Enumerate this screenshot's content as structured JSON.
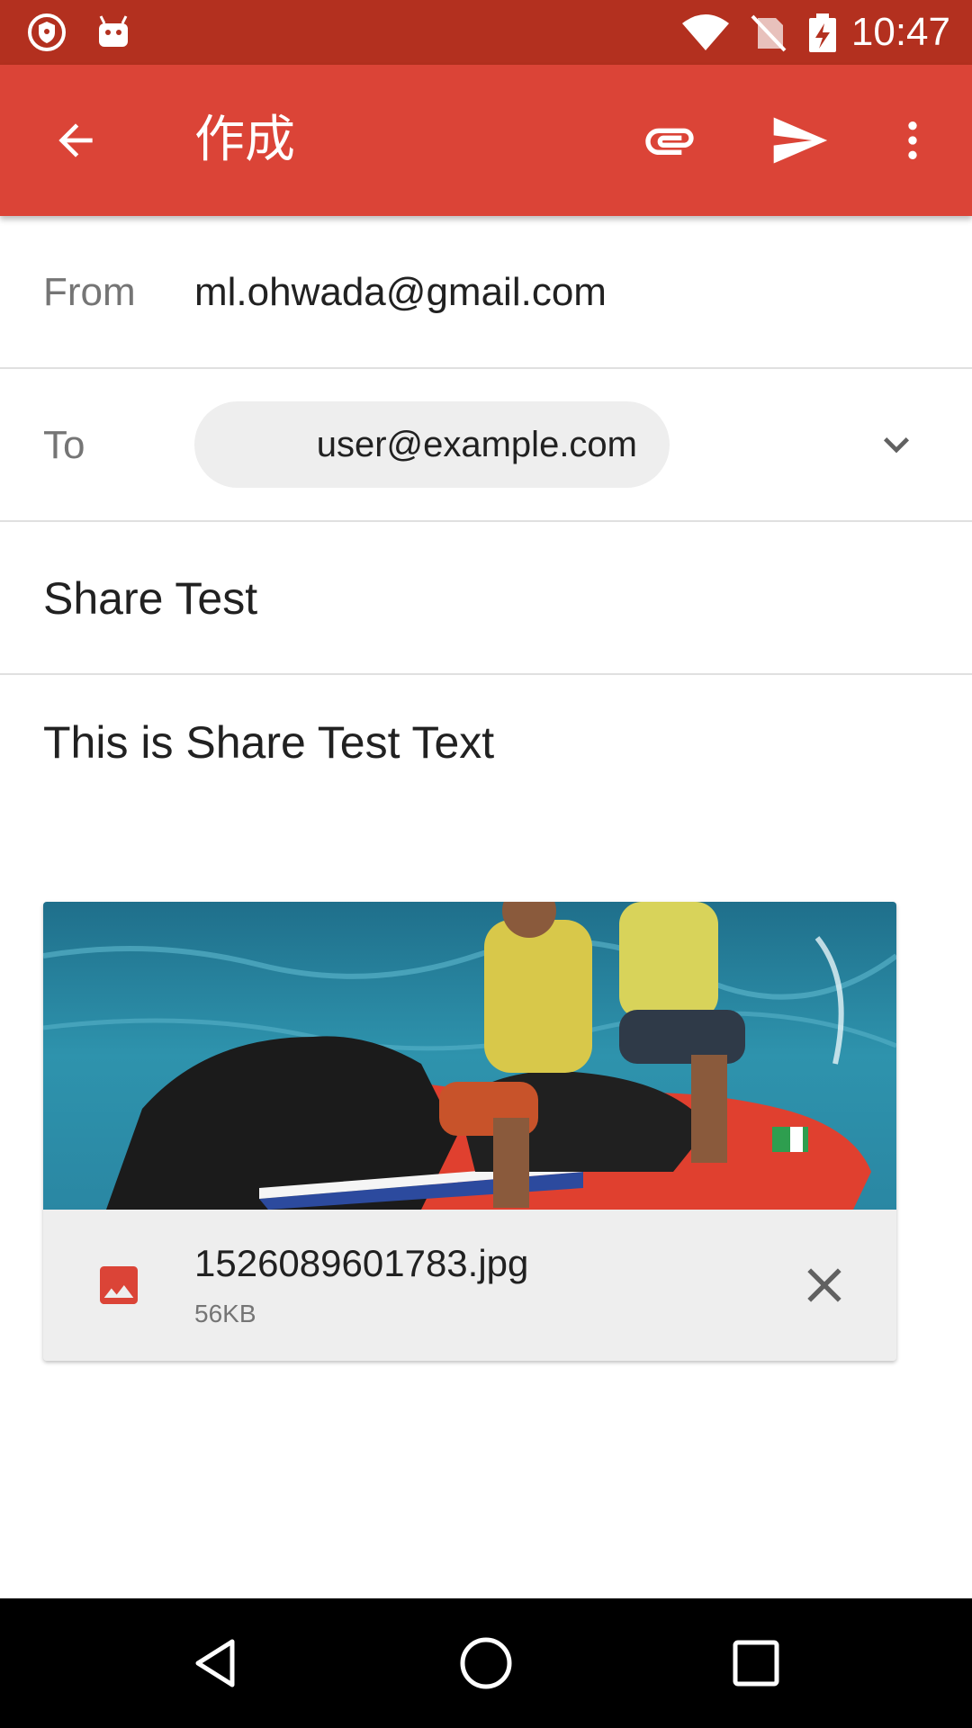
{
  "status_bar": {
    "time": "10:47",
    "left_icons": [
      "shield-icon",
      "android-icon"
    ],
    "right_icons": [
      "wifi-icon",
      "no-sim-icon",
      "battery-charging-icon"
    ]
  },
  "toolbar": {
    "title": "作成",
    "back_icon": "arrow-back-icon",
    "actions": [
      "attach-icon",
      "send-icon",
      "more-vert-icon"
    ]
  },
  "compose": {
    "from_label": "From",
    "from_value": "ml.ohwada@gmail.com",
    "to_label": "To",
    "to_chip": "user@example.com",
    "subject": "Share Test",
    "body": "This is Share Test Text"
  },
  "attachment": {
    "file_name": "1526089601783.jpg",
    "file_size": "56KB"
  },
  "colors": {
    "status_bar": "#b3301f",
    "toolbar": "#db4437",
    "file_icon": "#db4437"
  }
}
